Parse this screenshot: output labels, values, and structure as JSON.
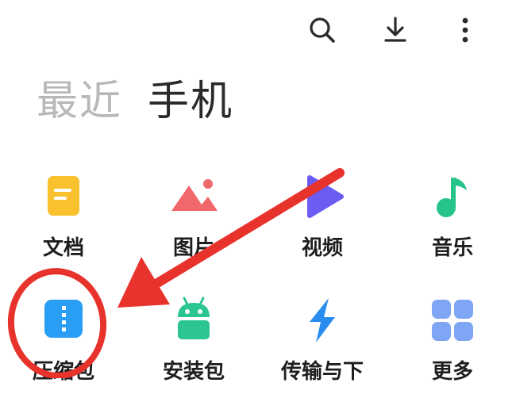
{
  "header": {
    "icons": [
      "search-icon",
      "download-icon",
      "more-vert-icon"
    ]
  },
  "tabs": [
    {
      "label": "最近",
      "active": false
    },
    {
      "label": "手机",
      "active": true
    }
  ],
  "categories": [
    {
      "label": "文档",
      "icon": "document-icon",
      "color": "#f9c12d"
    },
    {
      "label": "图片",
      "icon": "image-icon",
      "color": "#f1686a"
    },
    {
      "label": "视频",
      "icon": "video-icon",
      "color": "#6b5cf2"
    },
    {
      "label": "音乐",
      "icon": "music-icon",
      "color": "#27c48a"
    },
    {
      "label": "压缩包",
      "icon": "archive-icon",
      "color": "#2a9df4"
    },
    {
      "label": "安装包",
      "icon": "android-icon",
      "color": "#2bc58f"
    },
    {
      "label": "传输与下",
      "icon": "transfer-icon",
      "color": "#2a8cf0"
    },
    {
      "label": "更多",
      "icon": "more-grid-icon",
      "color": "#7fa6f4"
    }
  ],
  "annotation": {
    "color": "#e8322c"
  }
}
